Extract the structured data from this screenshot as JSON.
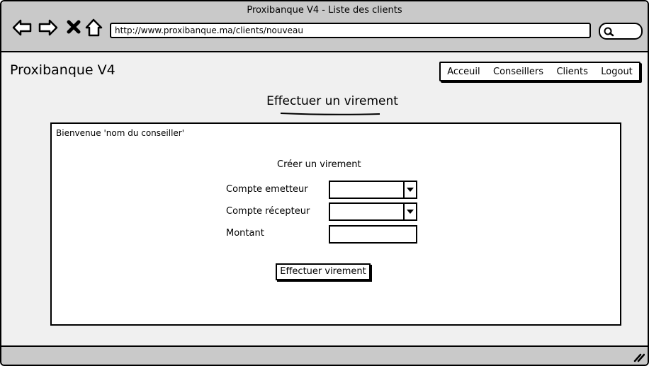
{
  "window": {
    "title": "Proxibanque V4 - Liste des clients"
  },
  "toolbar": {
    "url": "http://www.proxibanque.ma/clients/nouveau"
  },
  "app": {
    "brand": "Proxibanque V4"
  },
  "nav": {
    "items": [
      "Acceuil",
      "Conseillers",
      "Clients",
      "Logout"
    ]
  },
  "page": {
    "title": "Effectuer un virement"
  },
  "panel": {
    "welcome": "Bienvenue 'nom du conseiller'",
    "form_title": "Créer un virement",
    "label_emetteur": "Compte emetteur",
    "label_recepteur": "Compte récepteur",
    "label_montant": "Montant",
    "submit_label": "Effectuer virement"
  },
  "icons": [
    "back-arrow-icon",
    "forward-arrow-icon",
    "close-icon",
    "home-icon",
    "search-icon",
    "resize-grip-icon"
  ]
}
